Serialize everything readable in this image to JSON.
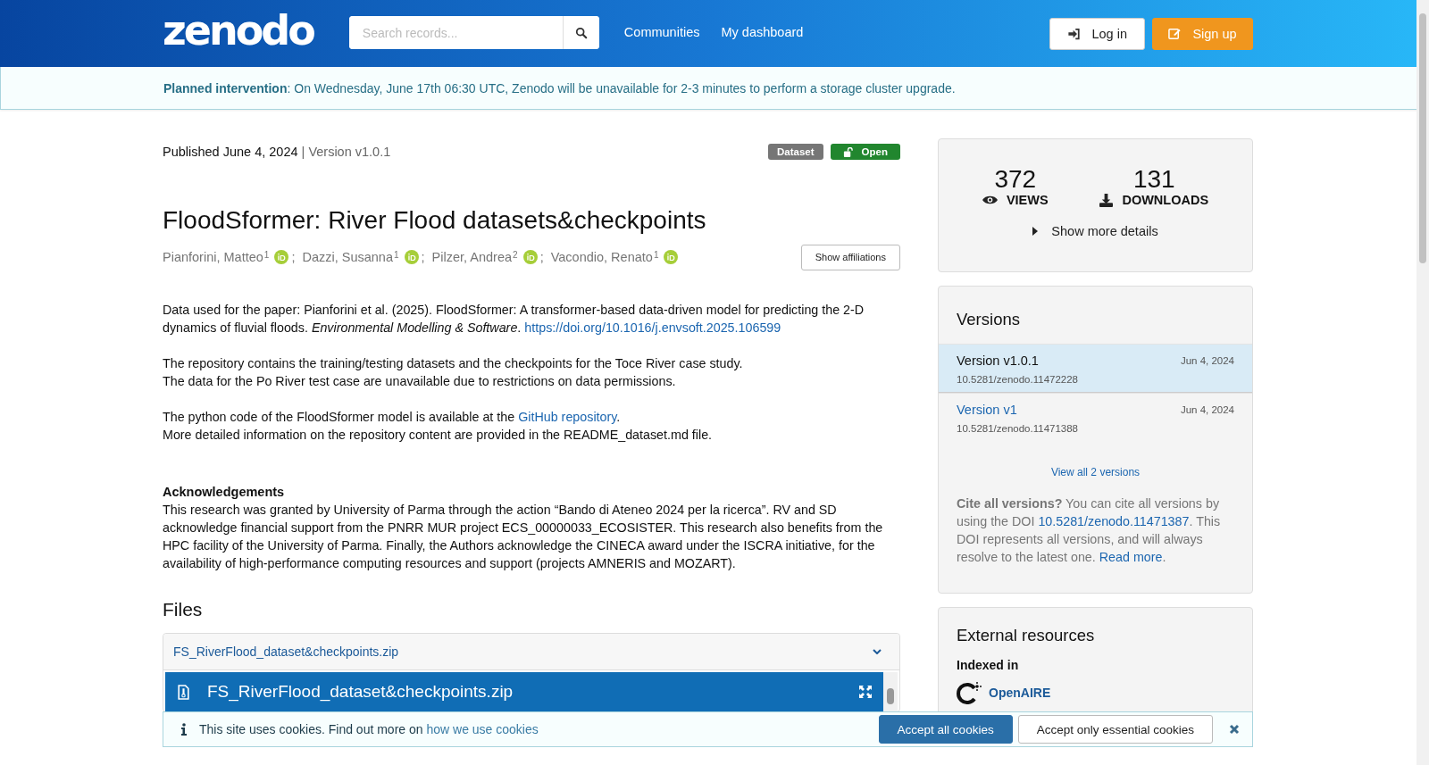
{
  "header": {
    "logo": "zenodo",
    "search": {
      "placeholder": "Search records..."
    },
    "nav": [
      "Communities",
      "My dashboard"
    ],
    "buttons": [
      {
        "label": "Log in",
        "kind": "login"
      },
      {
        "label": "Sign up",
        "kind": "signup"
      }
    ]
  },
  "announcement": {
    "title": "Planned intervention",
    "text": ": On Wednesday, June 17th 06:30 UTC, Zenodo will be unavailable for 2-3 minutes to perform a storage cluster upgrade."
  },
  "record": {
    "published": "Published June 4, 2024",
    "version": "| Version v1.0.1",
    "labels": [
      {
        "label": "Dataset",
        "kind": "type"
      },
      {
        "label": "Open",
        "kind": "access"
      }
    ],
    "title": "FloodSformer: River Flood datasets&checkpoints",
    "authors": [
      {
        "name": "Pianforini, Matteo",
        "aff": "1",
        "separator": ";"
      },
      {
        "name": "Dazzi, Susanna",
        "aff": "1",
        "separator": ";"
      },
      {
        "name": "Pilzer, Andrea",
        "aff": "2",
        "separator": ";"
      },
      {
        "name": "Vacondio, Renato",
        "aff": "1"
      }
    ],
    "show_affiliations": "Show affiliations",
    "description": [
      [
        {
          "kind": "text",
          "text": "Data used for the paper: Pianforini et al. (2025). FloodSformer: A transformer-based data-driven model for predicting the 2-D dynamics of fluvial floods. *Environmental Modelling & Software*. "
        },
        {
          "kind": "link",
          "text": "https://doi.org/10.1016/j.envsoft.2025.106599"
        }
      ],
      [
        {
          "kind": "text",
          "text": "The repository contains the training/testing datasets and the checkpoints for the Toce River case study."
        }
      ],
      [
        {
          "kind": "text",
          "text": "The data for the Po River test case are unavailable due to restrictions on data permissions."
        }
      ],
      [
        {
          "kind": "gap"
        }
      ],
      [
        {
          "kind": "text",
          "text": "The python code of the FloodSformer model is available at the "
        },
        {
          "kind": "link",
          "text": "GitHub repository"
        },
        {
          "kind": "text",
          "text": "."
        }
      ],
      [
        {
          "kind": "text",
          "text": "More detailed information on the repository content are provided in the README_dataset.md file."
        }
      ]
    ],
    "ack_title": "Acknowledgements",
    "ack_text": "This research was granted by University of Parma through the action “Bando di Ateneo 2024 per la ricerca”. RV and SD acknowledge financial support from the PNRR MUR project ECS_00000033_ECOSISTER. This research also benefits from the HPC facility of the University of Parma. Finally, the Authors acknowledge the CINECA award under the ISCRA initiative, for the availability of high-performance computing resources and support (projects AMNERIS and MOZART).",
    "files_title": "Files",
    "file_accordion": "FS_RiverFlood_dataset&checkpoints.zip",
    "preview_title": "FS_RiverFlood_dataset&checkpoints.zip"
  },
  "stats": {
    "items": [
      {
        "value": "372",
        "label": "VIEWS",
        "kind": "views"
      },
      {
        "value": "131",
        "label": "DOWNLOADS",
        "kind": "downloads"
      }
    ],
    "more": "Show more details"
  },
  "versions": {
    "title": "Versions",
    "items": [
      {
        "label": "Version v1.0.1",
        "date": "Jun 4, 2024",
        "doi": "10.5281/zenodo.11472228",
        "selected": true
      },
      {
        "label": "Version v1",
        "date": "Jun 4, 2024",
        "doi": "10.5281/zenodo.11471388",
        "selected": false
      }
    ],
    "view_all": "View all 2 versions",
    "cite": [
      {
        "kind": "bold",
        "text": "Cite all versions?"
      },
      {
        "kind": "text",
        "text": " You can cite all versions by using the DOI "
      },
      {
        "kind": "link",
        "text": "10.5281/zenodo.11471387"
      },
      {
        "kind": "text",
        "text": ". This DOI represents all versions, and will always resolve to the latest one. "
      },
      {
        "kind": "link",
        "text": "Read more"
      },
      {
        "kind": "text",
        "text": "."
      }
    ]
  },
  "external": {
    "title": "External resources",
    "indexed": "Indexed in",
    "items": [
      "OpenAIRE"
    ]
  },
  "cookie": {
    "text": "This site uses cookies. Find out more on ",
    "link": "how we use cookies",
    "buttons": [
      {
        "label": "Accept all cookies",
        "kind": "primary"
      },
      {
        "label": "Accept only essential cookies",
        "kind": "secondary"
      }
    ]
  }
}
